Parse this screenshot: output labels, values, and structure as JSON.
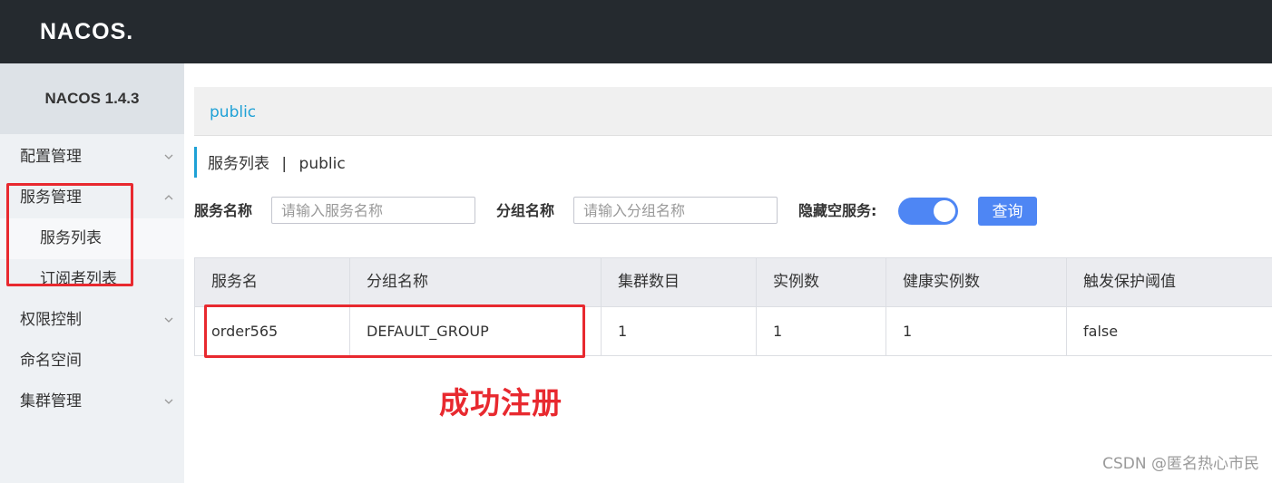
{
  "header": {
    "logo_text": "NACOS."
  },
  "sidebar": {
    "version": "NACOS 1.4.3",
    "items": [
      {
        "label": "配置管理",
        "expandable": true,
        "expanded": false
      },
      {
        "label": "服务管理",
        "expandable": true,
        "expanded": true
      },
      {
        "label": "服务列表",
        "sub": true,
        "active": true
      },
      {
        "label": "订阅者列表",
        "sub": true
      },
      {
        "label": "权限控制",
        "expandable": true,
        "expanded": false
      },
      {
        "label": "命名空间"
      },
      {
        "label": "集群管理",
        "expandable": true,
        "expanded": false
      }
    ]
  },
  "namespace_bar": {
    "current": "public"
  },
  "page": {
    "title": "服务列表",
    "separator": "|",
    "namespace": "public"
  },
  "filters": {
    "service_name_label": "服务名称",
    "service_name_placeholder": "请输入服务名称",
    "group_name_label": "分组名称",
    "group_name_placeholder": "请输入分组名称",
    "hide_empty_label": "隐藏空服务:",
    "hide_empty_on": true,
    "query_button": "查询"
  },
  "table": {
    "headers": [
      "服务名",
      "分组名称",
      "集群数目",
      "实例数",
      "健康实例数",
      "触发保护阈值"
    ],
    "rows": [
      [
        "order565",
        "DEFAULT_GROUP",
        "1",
        "1",
        "1",
        "false"
      ]
    ]
  },
  "annotation": {
    "text": "成功注册"
  },
  "watermark": "CSDN @匿名热心市民",
  "colors": {
    "topbar": "#252a2f",
    "accent": "#1fa1d6",
    "primary_button": "#4e86f4",
    "annotation_red": "#e8292f"
  }
}
